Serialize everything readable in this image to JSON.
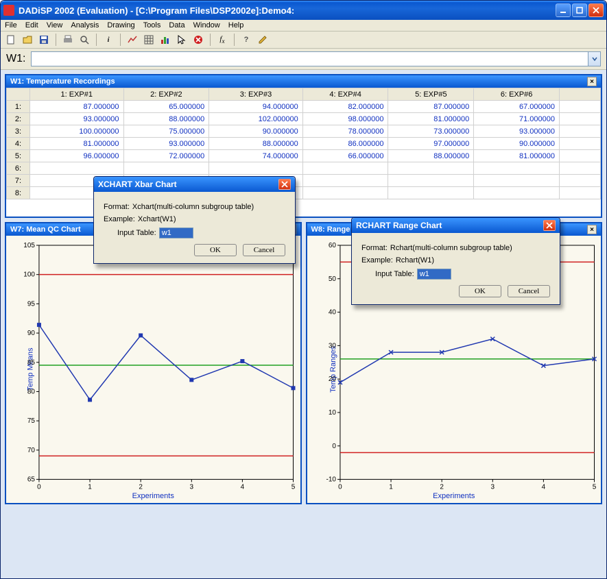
{
  "app": {
    "title": "DADiSP 2002 (Evaluation) - [C:\\Program Files\\DSP2002e]:Demo4:"
  },
  "menu": [
    "File",
    "Edit",
    "View",
    "Analysis",
    "Drawing",
    "Tools",
    "Data",
    "Window",
    "Help"
  ],
  "formulabar": {
    "label": "W1:",
    "value": ""
  },
  "table_pane": {
    "title": "W1: Temperature Recordings",
    "col_headers": [
      "1: EXP#1",
      "2: EXP#2",
      "3: EXP#3",
      "4: EXP#4",
      "5: EXP#5",
      "6: EXP#6"
    ],
    "row_headers": [
      "1:",
      "2:",
      "3:",
      "4:",
      "5:",
      "6:",
      "7:",
      "8:"
    ],
    "rows": [
      [
        "87.000000",
        "65.000000",
        "94.000000",
        "82.000000",
        "87.000000",
        "67.000000"
      ],
      [
        "93.000000",
        "88.000000",
        "102.000000",
        "98.000000",
        "81.000000",
        "71.000000"
      ],
      [
        "100.000000",
        "75.000000",
        "90.000000",
        "78.000000",
        "73.000000",
        "93.000000"
      ],
      [
        "81.000000",
        "93.000000",
        "88.000000",
        "86.000000",
        "97.000000",
        "90.000000"
      ],
      [
        "96.000000",
        "72.000000",
        "74.000000",
        "66.000000",
        "88.000000",
        "81.000000"
      ],
      [
        "",
        "",
        "",
        "",
        "",
        ""
      ],
      [
        "",
        "",
        "",
        "",
        "",
        ""
      ],
      [
        "",
        "",
        "",
        "",
        "",
        ""
      ]
    ]
  },
  "chart_left": {
    "title": "W7: Mean QC Chart",
    "xlabel": "Experiments",
    "ylabel": "Temp Means"
  },
  "chart_right": {
    "title": "W8: Range QC Chart",
    "xlabel": "Experiments",
    "ylabel": "Temp Ranges"
  },
  "dialog_x": {
    "title": "XCHART   Xbar Chart",
    "format_label": "Format:",
    "format_value": "Xchart(multi-column subgroup table)",
    "example_label": "Example:",
    "example_value": "Xchart(W1)",
    "input_label": "Input Table:",
    "input_value": "w1",
    "ok": "OK",
    "cancel": "Cancel"
  },
  "dialog_r": {
    "title": "RCHART   Range Chart",
    "format_label": "Format:",
    "format_value": "Rchart(multi-column subgroup table)",
    "example_label": "Example:",
    "example_value": "Rchart(W1)",
    "input_label": "Input Table:",
    "input_value": "w1",
    "ok": "OK",
    "cancel": "Cancel"
  },
  "chart_data": [
    {
      "type": "line",
      "title": "Mean QC Chart",
      "xlabel": "Experiments",
      "ylabel": "Temp Means",
      "x": [
        0,
        1,
        2,
        3,
        4,
        5
      ],
      "values": [
        91.4,
        78.6,
        89.6,
        82.0,
        85.2,
        80.6
      ],
      "center_line": 84.5,
      "ucl": 100,
      "lcl": 69,
      "xlim": [
        0,
        5
      ],
      "ylim": [
        65,
        105
      ],
      "yticks": [
        65,
        70,
        75,
        80,
        85,
        90,
        95,
        100,
        105
      ],
      "marker": "square"
    },
    {
      "type": "line",
      "title": "Range QC Chart",
      "xlabel": "Experiments",
      "ylabel": "Temp Ranges",
      "x": [
        0,
        1,
        2,
        3,
        4,
        5
      ],
      "values": [
        19,
        28,
        28,
        32,
        24,
        26
      ],
      "center_line": 26,
      "ucl": 55,
      "lcl": -2,
      "xlim": [
        0,
        5
      ],
      "ylim": [
        -10,
        60
      ],
      "yticks": [
        -10,
        0,
        10,
        20,
        30,
        40,
        50,
        60
      ],
      "marker": "x"
    }
  ]
}
